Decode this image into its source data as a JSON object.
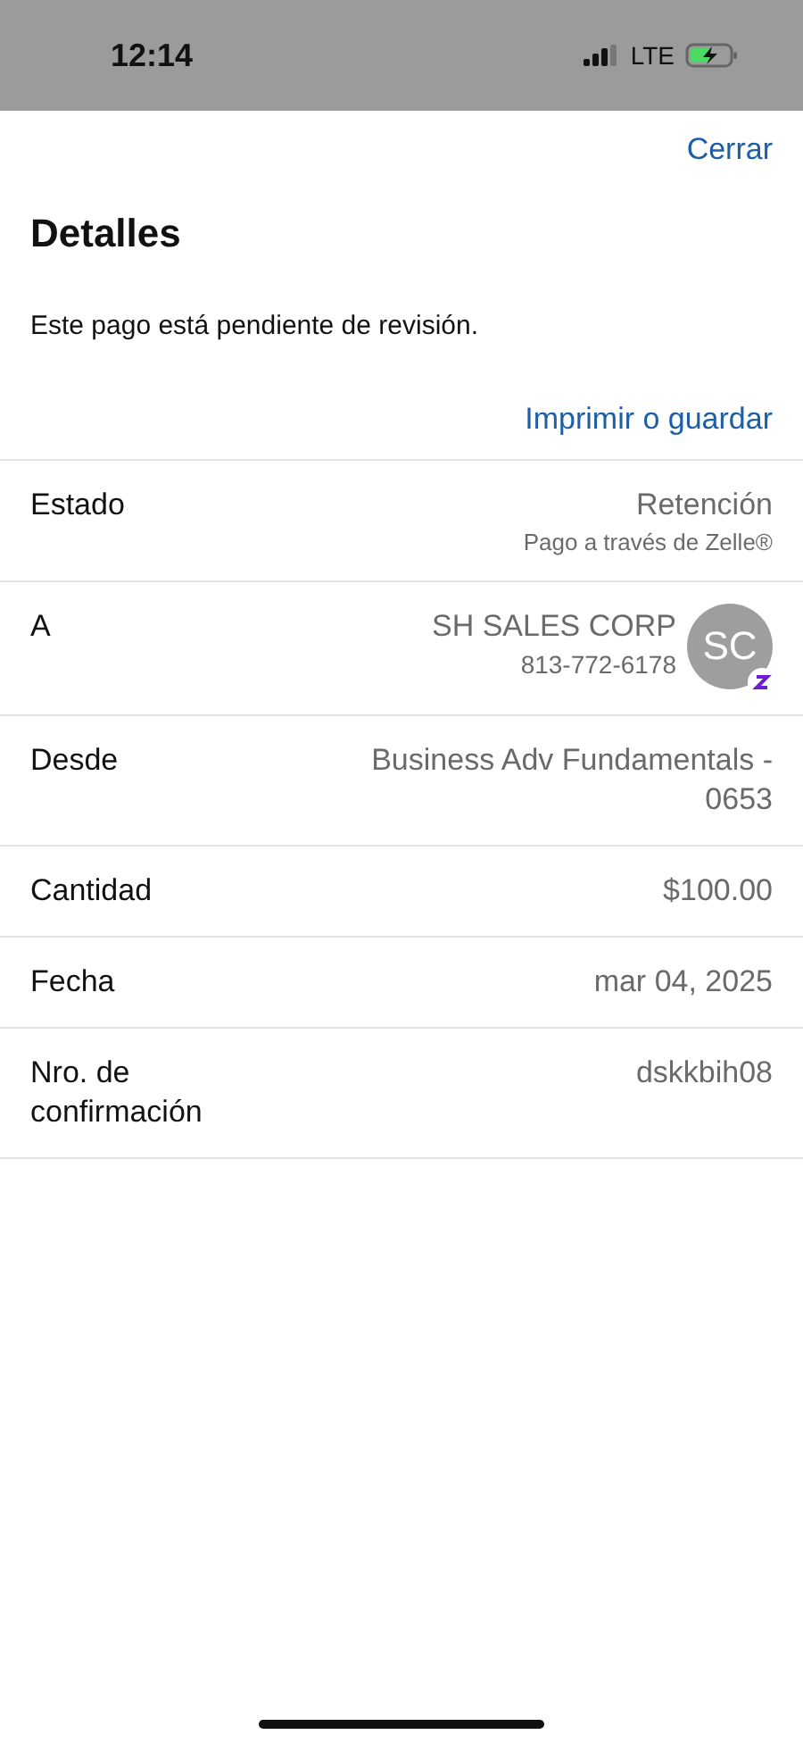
{
  "status_bar": {
    "time": "12:14",
    "network": "LTE"
  },
  "header": {
    "close": "Cerrar",
    "title": "Detalles",
    "message": "Este pago está pendiente de revisión.",
    "print_link": "Imprimir o guardar"
  },
  "rows": [
    {
      "label": "Estado",
      "value": "Retención",
      "sub": "Pago a través de Zelle®"
    },
    {
      "label": "A",
      "value": "SH SALES CORP",
      "sub": "813-772-6178",
      "avatar": "SC"
    },
    {
      "label": "Desde",
      "value": "Business Adv Fundamentals - 0653"
    },
    {
      "label": "Cantidad",
      "value": "$100.00"
    },
    {
      "label": "Fecha",
      "value": "mar 04, 2025"
    },
    {
      "label": "Nro. de confirmación",
      "value": "dskkbih08"
    }
  ]
}
